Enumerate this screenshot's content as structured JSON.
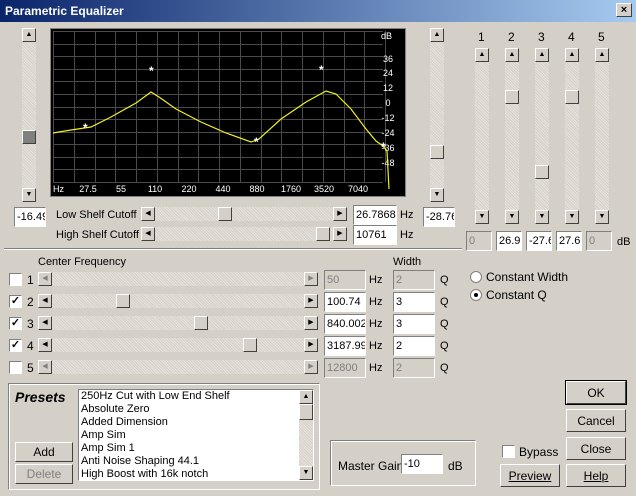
{
  "window": {
    "title": "Parametric Equalizer",
    "close_glyph": "×"
  },
  "graph": {
    "db_unit": "dB",
    "db_ticks": [
      "36",
      "24",
      "12",
      "0",
      "-12",
      "-24",
      "-36",
      "-48"
    ],
    "hz_unit": "Hz",
    "hz_ticks": [
      "27.5",
      "55",
      "110",
      "220",
      "440",
      "880",
      "1760",
      "3520",
      "7040"
    ]
  },
  "left_slider_value": "-16.49",
  "right_slider_value": "-28.76",
  "low_shelf": {
    "label": "Low Shelf Cutoff",
    "value": "26.7868",
    "unit": "Hz"
  },
  "high_shelf": {
    "label": "High Shelf Cutoff",
    "value": "10761",
    "unit": "Hz"
  },
  "band_sliders": {
    "labels": [
      "1",
      "2",
      "3",
      "4",
      "5"
    ],
    "values": [
      "0",
      "26.9",
      "-27.6",
      "27.6",
      "0"
    ],
    "unit": "dB"
  },
  "center_freq": {
    "header": "Center Frequency",
    "width_header": "Width",
    "hz_unit": "Hz",
    "q_unit": "Q",
    "bands": [
      {
        "num": "1",
        "checked": false,
        "freq": "50",
        "width": "2"
      },
      {
        "num": "2",
        "checked": true,
        "freq": "100.74",
        "width": "3"
      },
      {
        "num": "3",
        "checked": true,
        "freq": "840.002",
        "width": "3"
      },
      {
        "num": "4",
        "checked": true,
        "freq": "3187.99",
        "width": "2"
      },
      {
        "num": "5",
        "checked": false,
        "freq": "12800",
        "width": "2"
      }
    ]
  },
  "width_mode": {
    "constant_width": "Constant Width",
    "constant_q": "Constant Q"
  },
  "presets": {
    "title": "Presets",
    "items": [
      "250Hz Cut with Low End Shelf",
      "Absolute Zero",
      "Added Dimension",
      "Amp Sim",
      "Amp Sim 1",
      "Anti Noise Shaping 44.1",
      "High Boost with 16k notch"
    ],
    "add": "Add",
    "delete": "Delete"
  },
  "master_gain": {
    "label": "Master Gain",
    "value": "-10",
    "unit": "dB"
  },
  "bypass": "Bypass",
  "buttons": {
    "ok": "OK",
    "cancel": "Cancel",
    "close": "Close",
    "preview": "Preview",
    "help": "Help"
  },
  "colors": {
    "graph_bg": "#000000",
    "grid": "#4a4a4a",
    "curve": "#f0f020",
    "title_blue": "#0a246a"
  }
}
